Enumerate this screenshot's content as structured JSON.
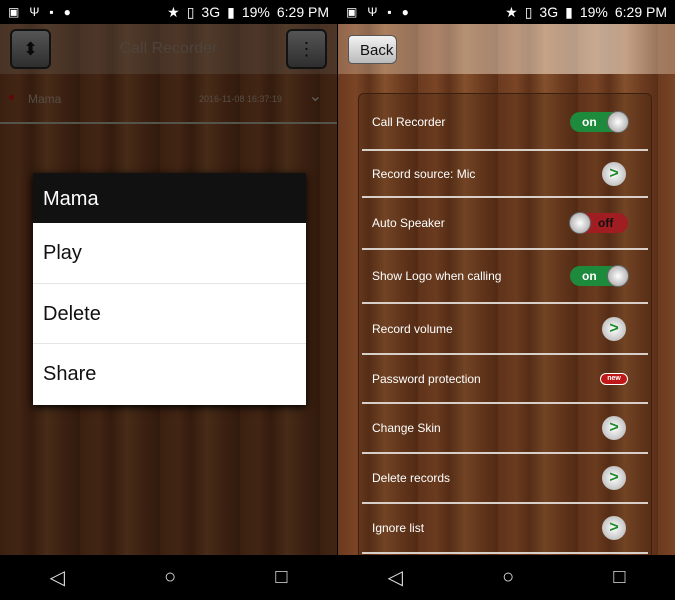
{
  "status_bar": {
    "battery": "19%",
    "network": "3G",
    "time": "6:29 PM"
  },
  "left": {
    "title": "Call Recorder",
    "record": {
      "name": "Mama",
      "datetime": "2016-11-08 16:37:19"
    },
    "dialog": {
      "title": "Mama",
      "items": [
        "Play",
        "Delete",
        "Share"
      ]
    }
  },
  "right": {
    "back_label": "Back",
    "settings": [
      {
        "label": "Call Recorder",
        "control": "toggle",
        "value": "on"
      },
      {
        "label": "Record source: Mic",
        "control": "arrow"
      },
      {
        "label": "Auto Speaker",
        "control": "toggle",
        "value": "off"
      },
      {
        "label": "Show Logo when calling",
        "control": "toggle",
        "value": "on"
      },
      {
        "label": "Record volume",
        "control": "arrow"
      },
      {
        "label": "Password protection",
        "control": "badge",
        "badge": "new"
      },
      {
        "label": "Change Skin",
        "control": "arrow"
      },
      {
        "label": "Delete records",
        "control": "arrow"
      },
      {
        "label": "Ignore list",
        "control": "arrow"
      }
    ]
  },
  "colors": {
    "toggle_on": "#1e8a3c",
    "toggle_off": "#a01d22",
    "arrow": "#1a8a2a"
  }
}
